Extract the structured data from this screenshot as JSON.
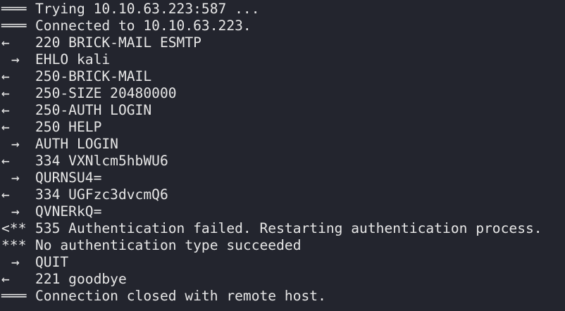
{
  "terminal": {
    "lines": [
      {
        "prefix": "═══",
        "text": "Trying 10.10.63.223:587 ..."
      },
      {
        "prefix": "═══",
        "text": "Connected to 10.10.63.223."
      },
      {
        "prefix": "←",
        "text": "220 BRICK-MAIL ESMTP"
      },
      {
        "prefix": "→",
        "text": "EHLO kali"
      },
      {
        "prefix": "←",
        "text": "250-BRICK-MAIL"
      },
      {
        "prefix": "←",
        "text": "250-SIZE 20480000"
      },
      {
        "prefix": "←",
        "text": "250-AUTH LOGIN"
      },
      {
        "prefix": "←",
        "text": "250 HELP"
      },
      {
        "prefix": "→",
        "text": "AUTH LOGIN"
      },
      {
        "prefix": "←",
        "text": "334 VXNlcm5hbWU6"
      },
      {
        "prefix": "→",
        "text": "QURNSU4="
      },
      {
        "prefix": "←",
        "text": "334 UGFzc3dvcmQ6"
      },
      {
        "prefix": "→",
        "text": "QVNERkQ="
      },
      {
        "prefix": "<**",
        "text": "535 Authentication failed. Restarting authentication process."
      },
      {
        "prefix": "***",
        "text": "No authentication type succeeded"
      },
      {
        "prefix": "→",
        "text": "QUIT"
      },
      {
        "prefix": "←",
        "text": "221 goodbye"
      },
      {
        "prefix": "═══",
        "text": "Connection closed with remote host."
      }
    ]
  }
}
